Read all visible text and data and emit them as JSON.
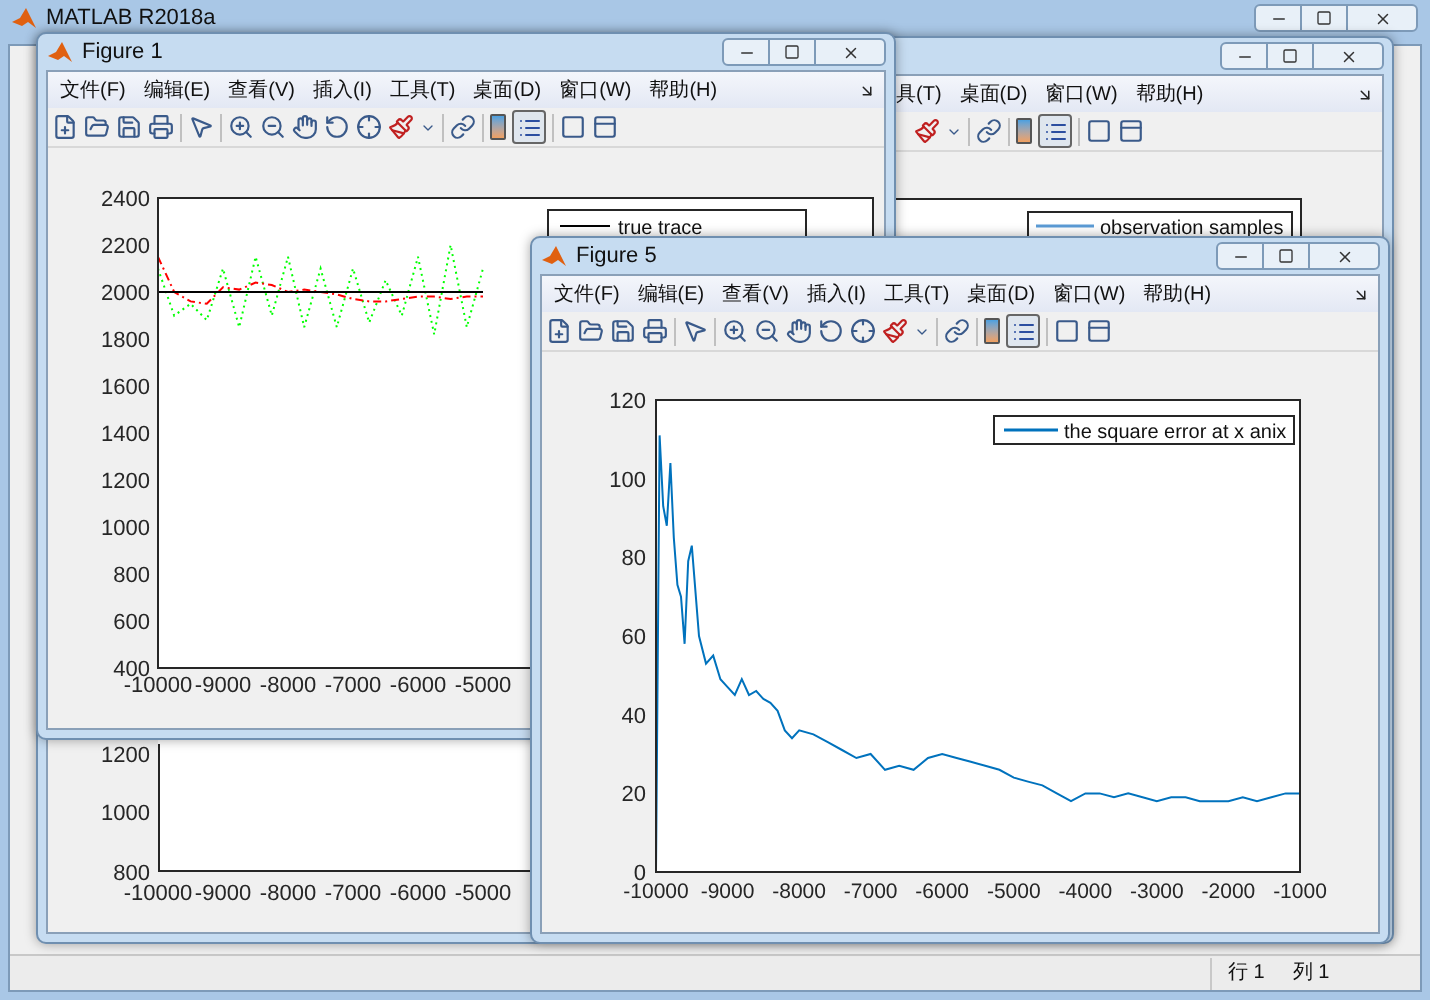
{
  "main_window": {
    "title": "MATLAB R2018a",
    "status_bar": {
      "row_label": "行",
      "row_value": "1",
      "column_label": "列",
      "column_value": "1"
    }
  },
  "back_figure": {
    "menu": [
      "具(T)",
      "桌面(D)",
      "窗口(W)",
      "帮助(H)"
    ],
    "legend_on": true,
    "legend": "observation samples",
    "yticks": [
      "1200",
      "1000",
      "800"
    ],
    "xticks": [
      "-10000",
      "-9000",
      "-8000",
      "-7000",
      "-6000",
      "-5000"
    ]
  },
  "figure_1": {
    "title": "Figure 1",
    "menu": [
      "文件(F)",
      "编辑(E)",
      "查看(V)",
      "插入(I)",
      "工具(T)",
      "桌面(D)",
      "窗口(W)",
      "帮助(H)"
    ],
    "legend_on": true,
    "chart_data": {
      "type": "line",
      "x": [
        -10000,
        -9750,
        -9500,
        -9250,
        -9000,
        -8750,
        -8500,
        -8250,
        -8000,
        -7750,
        -7500,
        -7250,
        -7000,
        -6750,
        -6500,
        -6250,
        -6000,
        -5750,
        -5500,
        -5250,
        -5000
      ],
      "series": [
        {
          "name": "true trace",
          "color": "#000000",
          "line_style": "solid",
          "values": [
            2000,
            2000,
            2000,
            2000,
            2000,
            2000,
            2000,
            2000,
            2000,
            2000,
            2000,
            2000,
            2000,
            2000,
            2000,
            2000,
            2000,
            2000,
            2000,
            2000,
            2000
          ]
        },
        {
          "color": "#ff0000",
          "line_style": "dashdot",
          "values": [
            2150,
            2000,
            1960,
            1950,
            2020,
            2010,
            2040,
            2030,
            2000,
            2010,
            2000,
            1990,
            1970,
            1960,
            1960,
            1970,
            1980,
            1980,
            1970,
            1980,
            1980
          ]
        },
        {
          "color": "#00ff00",
          "line_style": "dotted",
          "values": [
            2100,
            1900,
            1950,
            1880,
            2100,
            1850,
            2150,
            1900,
            2150,
            1850,
            2100,
            1850,
            2100,
            1870,
            2050,
            1900,
            2150,
            1820,
            2200,
            1850,
            2100
          ]
        }
      ],
      "xlim": [
        -10000,
        1000
      ],
      "ylim": [
        400,
        2400
      ],
      "yticks": [
        400,
        600,
        800,
        1000,
        1200,
        1400,
        1600,
        1800,
        2000,
        2200,
        2400
      ],
      "xticks": [
        -10000,
        -9000,
        -8000,
        -7000,
        -6000,
        -5000
      ]
    }
  },
  "figure_5": {
    "title": "Figure 5",
    "menu": [
      "文件(F)",
      "编辑(E)",
      "查看(V)",
      "插入(I)",
      "工具(T)",
      "桌面(D)",
      "窗口(W)",
      "帮助(H)"
    ],
    "legend_on": true,
    "chart_data": {
      "type": "line",
      "x": [
        -10000,
        -9950,
        -9900,
        -9850,
        -9800,
        -9750,
        -9700,
        -9650,
        -9600,
        -9550,
        -9500,
        -9400,
        -9300,
        -9200,
        -9100,
        -9000,
        -8900,
        -8800,
        -8700,
        -8600,
        -8500,
        -8400,
        -8300,
        -8200,
        -8100,
        -8000,
        -7800,
        -7600,
        -7400,
        -7200,
        -7000,
        -6800,
        -6600,
        -6400,
        -6200,
        -6000,
        -5800,
        -5600,
        -5400,
        -5200,
        -5000,
        -4800,
        -4600,
        -4400,
        -4200,
        -4000,
        -3800,
        -3600,
        -3400,
        -3200,
        -3000,
        -2800,
        -2600,
        -2400,
        -2200,
        -2000,
        -1800,
        -1600,
        -1400,
        -1200,
        -1000
      ],
      "series": [
        {
          "name": "the square error at x anix",
          "color": "#0072bd",
          "line_style": "solid",
          "values": [
            0,
            111,
            93,
            88,
            104,
            85,
            73,
            70,
            58,
            79,
            83,
            60,
            53,
            55,
            49,
            47,
            45,
            49,
            45,
            46,
            44,
            43,
            41,
            36,
            34,
            36,
            35,
            33,
            31,
            29,
            30,
            26,
            27,
            26,
            29,
            30,
            29,
            28,
            27,
            26,
            24,
            23,
            22,
            20,
            18,
            20,
            20,
            19,
            20,
            19,
            18,
            19,
            19,
            18,
            18,
            18,
            19,
            18,
            19,
            20,
            20
          ]
        }
      ],
      "xlim": [
        -10000,
        -1000
      ],
      "ylim": [
        0,
        120
      ],
      "yticks": [
        0,
        20,
        40,
        60,
        80,
        100,
        120
      ],
      "xticks": [
        -10000,
        -9000,
        -8000,
        -7000,
        -6000,
        -5000,
        -4000,
        -3000,
        -2000,
        -1000
      ]
    }
  }
}
